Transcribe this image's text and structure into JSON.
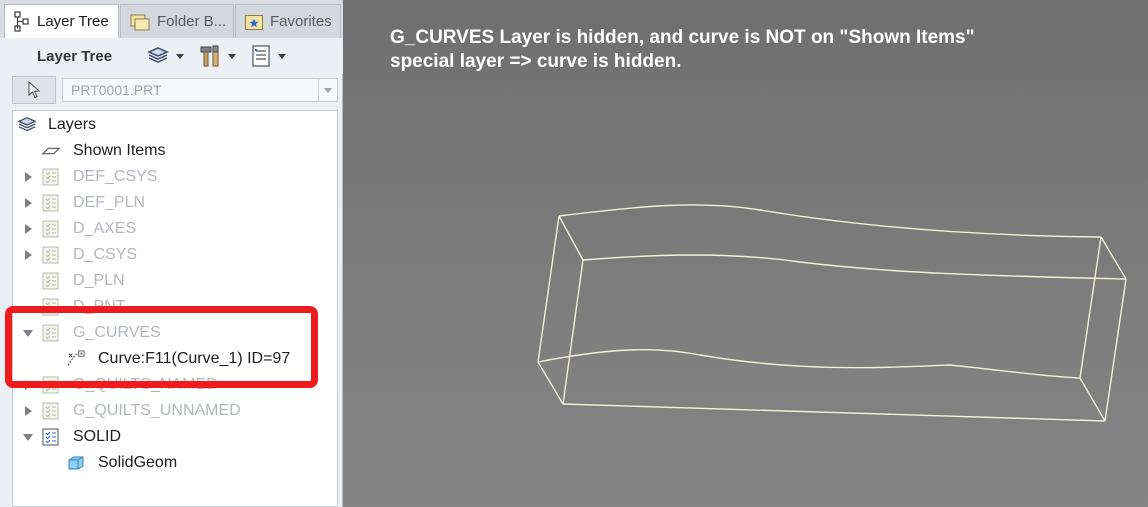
{
  "tabs": [
    {
      "label": "Layer Tree",
      "icon": "layer-tree-icon",
      "active": true
    },
    {
      "label": "Folder B...",
      "icon": "folder-browser-icon",
      "active": false
    },
    {
      "label": "Favorites",
      "icon": "favorites-icon",
      "active": false
    }
  ],
  "toolbar": {
    "title": "Layer Tree",
    "buttons": [
      "layers-icon",
      "tools-icon",
      "settings-icon"
    ]
  },
  "selector": {
    "value": "PRT0001.PRT"
  },
  "tree": {
    "root": "Layers",
    "items": [
      {
        "label": "Shown Items",
        "state": "normal",
        "expander": "none",
        "icon": "shown-items-icon"
      },
      {
        "label": "DEF_CSYS",
        "state": "dimmed",
        "expander": "collapsed",
        "icon": "layer-icon"
      },
      {
        "label": "DEF_PLN",
        "state": "dimmed",
        "expander": "collapsed",
        "icon": "layer-icon"
      },
      {
        "label": "D_AXES",
        "state": "dimmed",
        "expander": "collapsed",
        "icon": "layer-icon"
      },
      {
        "label": "D_CSYS",
        "state": "dimmed",
        "expander": "collapsed",
        "icon": "layer-icon"
      },
      {
        "label": "D_PLN",
        "state": "dimmed",
        "expander": "none",
        "icon": "layer-icon"
      },
      {
        "label": "D_PNT",
        "state": "dimmed",
        "expander": "none",
        "icon": "layer-icon"
      },
      {
        "label": "G_CURVES",
        "state": "dimmed",
        "expander": "expanded",
        "icon": "layer-icon"
      },
      {
        "label": "Curve:F11(Curve_1) ID=97",
        "state": "normal",
        "expander": "none",
        "icon": "curve-icon"
      },
      {
        "label": "G_QUILTS_NAMED",
        "state": "dimmed",
        "expander": "collapsed",
        "icon": "layer-icon"
      },
      {
        "label": "G_QUILTS_UNNAMED",
        "state": "dimmed",
        "expander": "collapsed",
        "icon": "layer-icon"
      },
      {
        "label": "SOLID",
        "state": "normal",
        "expander": "expanded",
        "icon": "layer-icon"
      },
      {
        "label": "SolidGeom",
        "state": "normal",
        "expander": "none",
        "icon": "solid-geom-icon"
      }
    ]
  },
  "annotation": {
    "line1": "G_CURVES Layer is hidden, and curve is NOT on \"Shown Items\"",
    "line2": "special layer => curve is hidden."
  },
  "colors": {
    "highlight": "#ee1c1c",
    "model_edges": "#f2efd8",
    "background": "#7a7a7a"
  }
}
